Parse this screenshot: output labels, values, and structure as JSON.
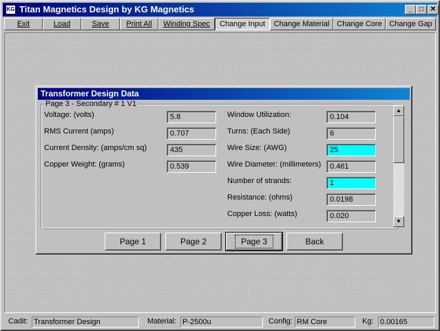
{
  "window": {
    "title": "Titan Magnetics Design by KG Magnetics",
    "app_icon_text": "KG",
    "minimize_glyph": "_",
    "maximize_glyph": "□",
    "close_glyph": "✕"
  },
  "menu": [
    {
      "label": "Exit"
    },
    {
      "label": "Load"
    },
    {
      "label": "Save"
    },
    {
      "label": "Print All"
    },
    {
      "label": "Winding Spec"
    },
    {
      "label": "Change Input"
    },
    {
      "label": "Change Material"
    },
    {
      "label": "Change Core"
    },
    {
      "label": "Change Gap"
    }
  ],
  "dialog": {
    "title": "Transformer Design Data",
    "group_label": "Page 3 -  Secondary # 1   V1",
    "left_fields": [
      {
        "label": "Voltage: (volts)",
        "value": "5.8"
      },
      {
        "label": "RMS Current (amps)",
        "value": "0.707"
      },
      {
        "label": "Current Density: (amps/cm sq)",
        "value": "435"
      },
      {
        "label": "Copper Weight: (grams)",
        "value": "0.539"
      }
    ],
    "right_fields": [
      {
        "label": "Window Utilization:",
        "value": "0.104",
        "highlight": false
      },
      {
        "label": "Turns: (Each Side)",
        "value": "6",
        "highlight": false
      },
      {
        "label": "Wire Size: (AWG)",
        "value": "25",
        "highlight": true
      },
      {
        "label": "Wire Diameter: (millimeters)",
        "value": "0.461",
        "highlight": false
      },
      {
        "label": "Number of strands:",
        "value": "1",
        "highlight": true
      },
      {
        "label": "Resistance: (ohms)",
        "value": "0.0198",
        "highlight": false
      },
      {
        "label": "Copper Loss: (watts)",
        "value": "0.020",
        "highlight": false
      }
    ],
    "buttons": [
      {
        "label": "Page 1"
      },
      {
        "label": "Page 2"
      },
      {
        "label": "Page 3"
      },
      {
        "label": "Back"
      }
    ],
    "scroll_up_glyph": "▲",
    "scroll_down_glyph": "▼"
  },
  "status": {
    "cadit_label": "Cadit:",
    "cadit_value": "Transformer Design",
    "material_label": "Material:",
    "material_value": "P-2500u",
    "config_label": "Config:",
    "config_value": "RM Core",
    "kg_label": "Kg:",
    "kg_value": "0.00165"
  },
  "colors": {
    "title_bar": "#000080",
    "highlight_field": "#00ffff",
    "face": "#c0c0c0"
  }
}
